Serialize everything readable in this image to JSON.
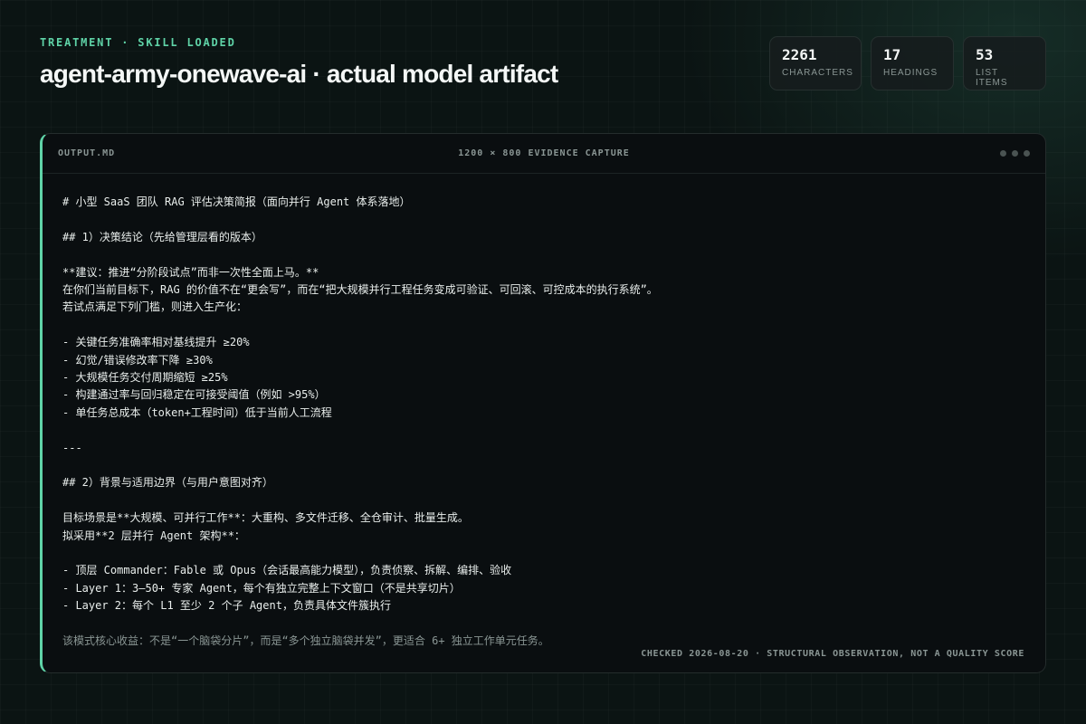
{
  "header": {
    "eyebrow": "TREATMENT · SKILL LOADED",
    "title": "agent-army-onewave-ai · actual model artifact"
  },
  "stats": [
    {
      "value": "2261",
      "label": "CHARACTERS"
    },
    {
      "value": "17",
      "label": "HEADINGS"
    },
    {
      "value": "53",
      "label": "LIST ITEMS"
    }
  ],
  "panel": {
    "filename": "OUTPUT.MD",
    "caption": "1200 × 800 EVIDENCE CAPTURE",
    "lines": [
      "# 小型 SaaS 团队 RAG 评估决策简报（面向并行 Agent 体系落地）",
      "",
      "## 1）决策结论（先给管理层看的版本）",
      "",
      "**建议：推进“分阶段试点”而非一次性全面上马。**",
      "在你们当前目标下，RAG 的价值不在“更会写”，而在“把大规模并行工程任务变成可验证、可回滚、可控成本的执行系统”。",
      "若试点满足下列门槛，则进入生产化：",
      "",
      "- 关键任务准确率相对基线提升 ≥20%",
      "- 幻觉/错误修改率下降 ≥30%",
      "- 大规模任务交付周期缩短 ≥25%",
      "- 构建通过率与回归稳定在可接受阈值（例如 >95%）",
      "- 单任务总成本（token+工程时间）低于当前人工流程",
      "",
      "---",
      "",
      "## 2）背景与适用边界（与用户意图对齐）",
      "",
      "目标场景是**大规模、可并行工作**：大重构、多文件迁移、全仓审计、批量生成。",
      "拟采用**2 层并行 Agent 架构**：",
      "",
      "- 顶层 Commander：Fable 或 Opus（会话最高能力模型），负责侦察、拆解、编排、验收",
      "- Layer 1：3–50+ 专家 Agent，每个有独立完整上下文窗口（不是共享切片）",
      "- Layer 2：每个 L1 至少 2 个子 Agent，负责具体文件簇执行",
      "",
      "该模式核心收益：不是“一个脑袋分片”，而是“多个独立脑袋并发”，更适合 6+ 独立工作单元任务。"
    ],
    "footnote": "CHECKED 2026-08-20 · STRUCTURAL OBSERVATION, NOT A QUALITY SCORE"
  },
  "colors": {
    "accent": "#5fd3a7",
    "background": "#0b1413",
    "panel": "#0a0e10",
    "muted": "#8a9694"
  },
  "icons": [
    "window-dots-icon"
  ]
}
